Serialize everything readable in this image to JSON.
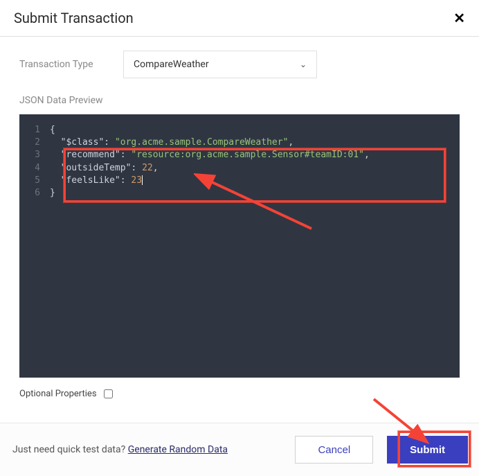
{
  "header": {
    "title": "Submit Transaction"
  },
  "form": {
    "type_label": "Transaction Type",
    "type_value": "CompareWeather"
  },
  "preview_label": "JSON Data Preview",
  "code_lines": [
    {
      "n": 1,
      "kind": "brace-open"
    },
    {
      "n": 2,
      "kind": "kv-str",
      "key": "$class",
      "val": "org.acme.sample.CompareWeather",
      "comma": true
    },
    {
      "n": 3,
      "kind": "kv-str",
      "key": "recommend",
      "val": "resource:org.acme.sample.Sensor#teamID:01",
      "comma": true
    },
    {
      "n": 4,
      "kind": "kv-num",
      "key": "outsideTemp",
      "val": 22,
      "comma": true
    },
    {
      "n": 5,
      "kind": "kv-num",
      "key": "feelsLike",
      "val": 23,
      "comma": false,
      "cursor": true
    },
    {
      "n": 6,
      "kind": "brace-close"
    }
  ],
  "optional": {
    "label": "Optional Properties",
    "checked": false
  },
  "footer": {
    "hint_prefix": "Just need quick test data? ",
    "hint_link": "Generate Random Data",
    "cancel": "Cancel",
    "submit": "Submit"
  }
}
